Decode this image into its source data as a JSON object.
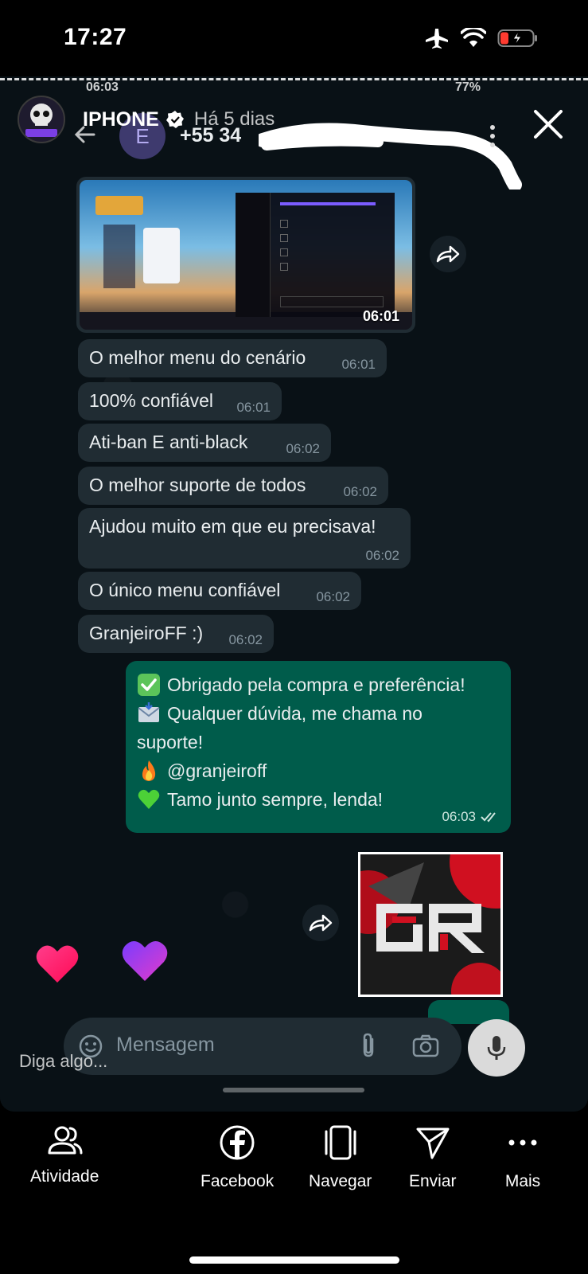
{
  "device_status": {
    "time": "17:27"
  },
  "recording_status": {
    "time": "06:03",
    "battery": "77%"
  },
  "story": {
    "username": "IPHONE",
    "age": "Há 5 dias",
    "avatar_text": "MOD MENU"
  },
  "chat_header": {
    "avatar_letter": "E",
    "number": "+55 34"
  },
  "image_message": {
    "time": "06:01"
  },
  "messages": [
    {
      "text": "O melhor menu do cenário",
      "time": "06:01"
    },
    {
      "text": "100% confiável",
      "time": "06:01"
    },
    {
      "text": "Ati-ban E anti-black",
      "time": "06:02"
    },
    {
      "text": "O melhor suporte de todos",
      "time": "06:02"
    },
    {
      "text": "Ajudou muito em que eu precisava!",
      "time": "06:02"
    },
    {
      "text": "O único menu confiável",
      "time": "06:02"
    },
    {
      "text": "GranjeiroFF :)",
      "time": "06:02"
    }
  ],
  "outgoing": {
    "line1": "Obrigado pela compra e preferência!",
    "line2": "Qualquer dúvida, me chama no",
    "line3": "suporte!",
    "line4": "@granjeiroff",
    "line5": "Tamo junto sempre, lenda!",
    "time": "06:03"
  },
  "composer": {
    "placeholder": "Mensagem"
  },
  "reply_hint": "Diga algo...",
  "actions": [
    {
      "label": "Atividade",
      "icon": "people-icon"
    },
    {
      "label": "Facebook",
      "icon": "facebook-icon"
    },
    {
      "label": "Navegar",
      "icon": "phone-frame-icon"
    },
    {
      "label": "Enviar",
      "icon": "send-icon"
    },
    {
      "label": "Mais",
      "icon": "more-icon"
    }
  ],
  "colors": {
    "chat_bg": "#0b141a",
    "incoming_bubble": "#202c33",
    "outgoing_bubble": "#005c4b",
    "battery_red": "#ff3b30"
  }
}
